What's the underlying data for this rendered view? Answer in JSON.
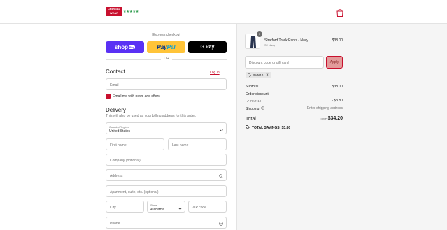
{
  "brand": {
    "logo_line1": "CRUCIAL",
    "logo_line2": "WEAR",
    "rating_stars": "★★★★★",
    "accent_color": "#c8102e"
  },
  "header": {
    "cart_icon": "shopping-bag-icon"
  },
  "express": {
    "label": "Express checkout",
    "shoppay_label": "shop",
    "shoppay_pill": "Pay",
    "paypal_label_1": "Pay",
    "paypal_label_2": "Pal",
    "gpay_g": "G",
    "gpay_label": "Pay",
    "or_text": "OR"
  },
  "contact": {
    "heading": "Contact",
    "login_label": "Log in",
    "email_placeholder": "Email",
    "newsletter_label": "Email me with news and offers",
    "newsletter_checked": true
  },
  "delivery": {
    "heading": "Delivery",
    "subtitle": "This will also be used as your billing address for this order.",
    "country_label": "Country/Region",
    "country_value": "United States",
    "first_name_placeholder": "First name",
    "last_name_placeholder": "Last name",
    "company_placeholder": "Company (optional)",
    "address_placeholder": "Address",
    "apartment_placeholder": "Apartment, suite, etc. (optional)",
    "city_placeholder": "City",
    "state_label": "State",
    "state_value": "Alabama",
    "zip_placeholder": "ZIP code",
    "phone_placeholder": "Phone"
  },
  "summary": {
    "product": {
      "title": "Stratford Track Pants - Navy",
      "variant": "S / Navy",
      "price": "$38.00",
      "quantity": "1"
    },
    "discount_placeholder": "Discount code or gift card",
    "apply_label": "Apply",
    "applied_code": "RMN10",
    "subtotal_label": "Subtotal",
    "subtotal_value": "$38.00",
    "order_discount_label": "Order discount",
    "discount_code": "RMN10",
    "discount_value": "- $3.80",
    "shipping_label": "Shipping",
    "shipping_value": "Enter shipping address",
    "total_label": "Total",
    "currency": "USD",
    "total_value": "$34.20",
    "savings_label": "TOTAL SAVINGS",
    "savings_value": "$3.80"
  }
}
